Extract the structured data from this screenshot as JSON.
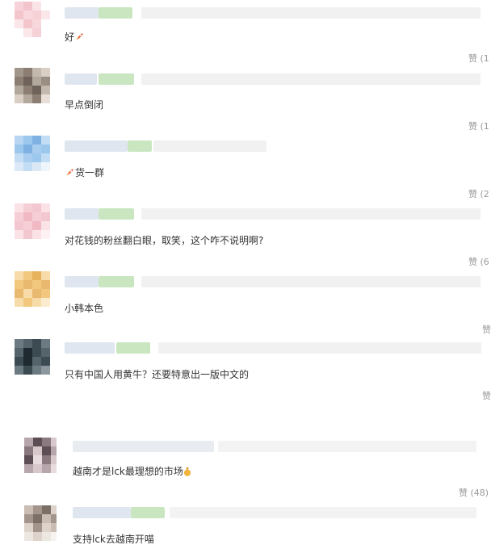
{
  "comments": [
    {
      "text": "好",
      "emoji": "rocket-emoji",
      "emoji_pos": "after",
      "like": "赞 (1",
      "palette": [
        "#f8d8dc",
        "#f3c6cc",
        "#fbe6e9",
        "#f6d2d7"
      ]
    },
    {
      "text": "早点倒闭",
      "like": "赞 (1",
      "palette": [
        "#8c7e72",
        "#6e625a",
        "#b3a89c",
        "#d9cfc4"
      ]
    },
    {
      "text": "货一群",
      "emoji": "rocket-emoji",
      "emoji_pos": "before",
      "like": "赞 (2",
      "palette": [
        "#9cc8ee",
        "#7fb2e2",
        "#c2ddf4",
        "#a9cdef"
      ]
    },
    {
      "text": "对花钱的粉丝翻白眼，取笑，这个咋不说明啊?",
      "like": "赞 (6",
      "palette": [
        "#f6cfd6",
        "#f0b9c4",
        "#fae2e7",
        "#f3c7d0"
      ]
    },
    {
      "text": "小韩本色",
      "like": "赞",
      "palette": [
        "#f1c87e",
        "#e6b25c",
        "#f7dcaa",
        "#eab970"
      ]
    },
    {
      "text": "只有中国人用黄牛？还要特意出一版中文的",
      "like": "赞",
      "palette": [
        "#3c4a52",
        "#1f2a30",
        "#6c7a82",
        "#55636b"
      ]
    },
    {
      "text": "越南才是lck最理想的市场",
      "emoji": "money-bag-emoji",
      "emoji_pos": "after",
      "like": "赞 (48)",
      "palette": [
        "#8a7a80",
        "#d8c8cc",
        "#5c4e54",
        "#b7a7ad"
      ]
    },
    {
      "text": "支持lck去越南开喵",
      "like": "",
      "palette": [
        "#a3958c",
        "#c9bdb4",
        "#7c6f66",
        "#ddd3cb"
      ]
    }
  ]
}
